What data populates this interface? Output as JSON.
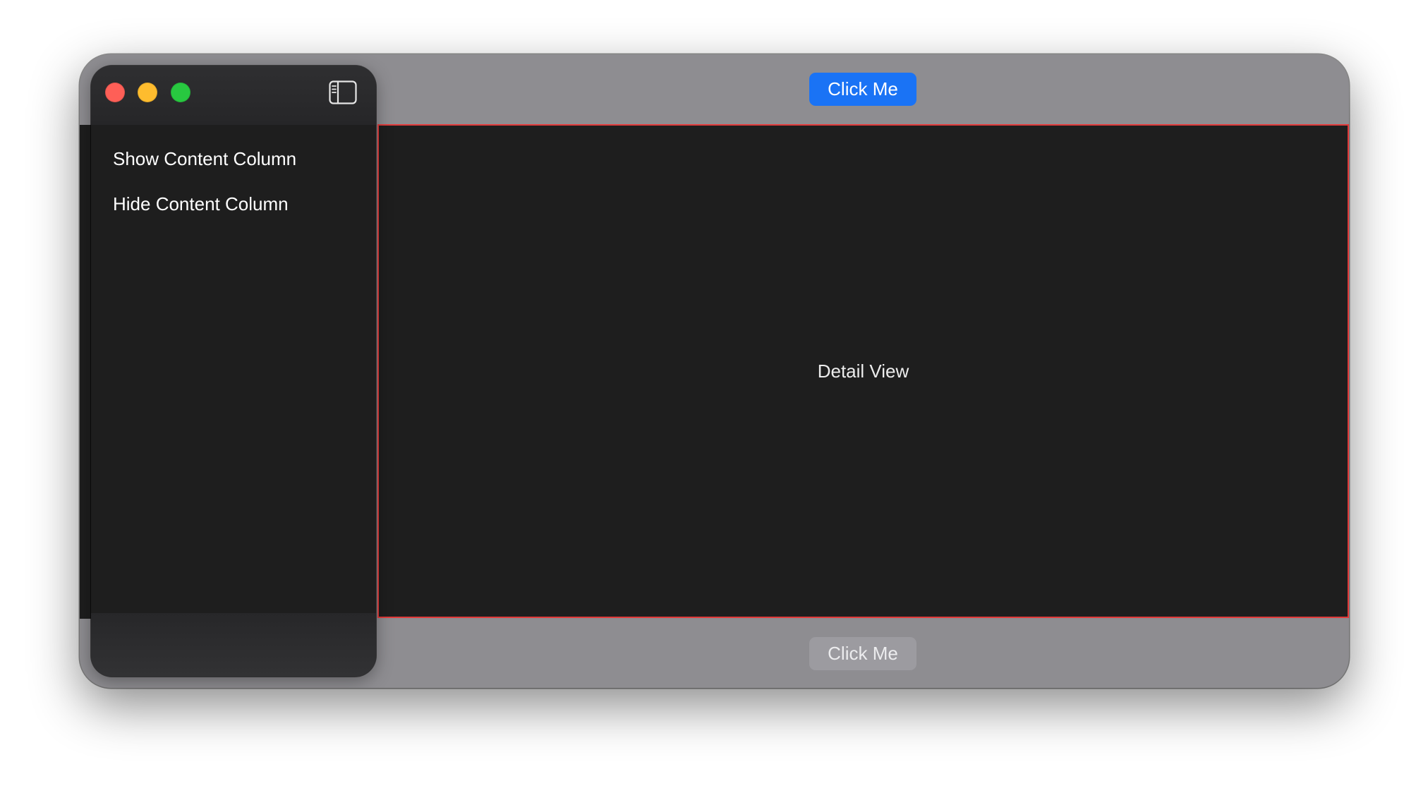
{
  "window": {
    "traffic_lights": {
      "close_color": "#fe5f57",
      "minimize_color": "#febc2e",
      "zoom_color": "#28c840"
    },
    "sidebar_toggle_icon": "sidebar-left-icon"
  },
  "sidebar": {
    "items": [
      {
        "label": "Show Content Column"
      },
      {
        "label": "Hide Content Column"
      }
    ]
  },
  "toolbar": {
    "top_button_label": "Click Me",
    "bottom_button_label": "Click Me",
    "accent_color": "#1a73f5"
  },
  "detail": {
    "label": "Detail View",
    "border_color": "#e23b3b"
  }
}
